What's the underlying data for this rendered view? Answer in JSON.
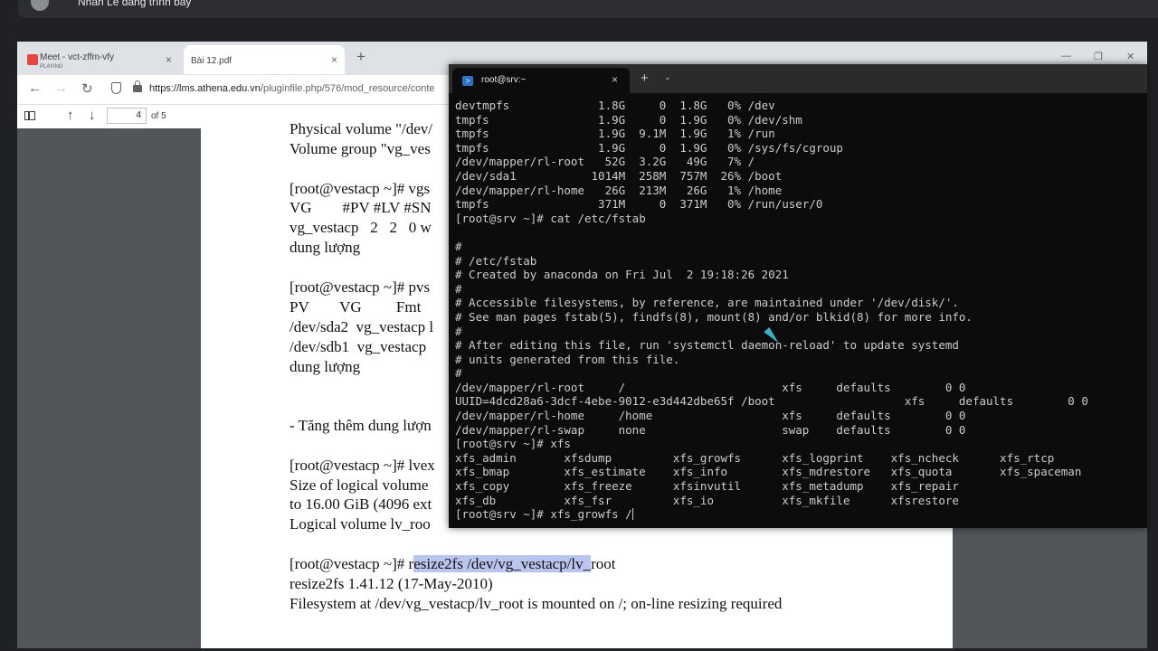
{
  "meet": {
    "presenter": "Nhân Lê đang trình bày"
  },
  "browser": {
    "tabs": [
      {
        "title": "Meet - vct-zffm-vfy",
        "subtitle": "PLAYING",
        "close": "×"
      },
      {
        "title": "Bài 12.pdf",
        "close": "×"
      }
    ],
    "new_tab": "+",
    "nav": {
      "back": "←",
      "forward": "→",
      "reload": "↻"
    },
    "url_domain": "https://lms.athena.edu.vn",
    "url_path": "/pluginfile.php/576/mod_resource/conte",
    "window_controls": {
      "minimize": "—",
      "maximize": "❐",
      "close": "✕"
    }
  },
  "pdf": {
    "toolbar": {
      "up": "↑",
      "down": "↓",
      "page": "4",
      "total": "of 5"
    },
    "lines": [
      {
        "id": "l1",
        "text": "Physical volume \"/dev/"
      },
      {
        "id": "l2",
        "text": "Volume group \"vg_ves"
      },
      {
        "id": "l3",
        "text": "[root@vestacp ~]# vgs"
      },
      {
        "id": "l4",
        "text": "VG        #PV #LV #SN"
      },
      {
        "id": "l5",
        "text": "vg_vestacp   2   2   0 w"
      },
      {
        "id": "l6",
        "text": "dung lượng"
      },
      {
        "id": "l7",
        "text": "[root@vestacp ~]# pvs"
      },
      {
        "id": "l8",
        "text": "PV        VG         Fmt"
      },
      {
        "id": "l9",
        "text": "/dev/sda2  vg_vestacp l"
      },
      {
        "id": "l10",
        "text": "/dev/sdb1  vg_vestacp"
      },
      {
        "id": "l11",
        "text": "dung lượng"
      },
      {
        "id": "l12",
        "text": "- Tăng thêm dung lượn"
      },
      {
        "id": "l13",
        "text": "[root@vestacp ~]# lvex"
      },
      {
        "id": "l14",
        "text": "Size of logical volume"
      },
      {
        "id": "l15",
        "text": "to 16.00 GiB (4096 ext"
      },
      {
        "id": "l16",
        "text": "Logical volume lv_roo"
      }
    ],
    "resize_prompt": "[root@vestacp ~]# r",
    "resize_hl": "esize2fs /dev/vg_vestacp/lv_",
    "resize_tail": "root",
    "line_version": "resize2fs 1.41.12 (17-May-2010)",
    "line_fs": "Filesystem at /dev/vg_vestacp/lv_root is mounted on /; on-line resizing required"
  },
  "terminal": {
    "tab_title": "root@srv:~",
    "tab_close": "×",
    "new_tab": "+",
    "dropdown": "⌄",
    "icon": "powershell-icon",
    "output": "devtmpfs             1.8G     0  1.8G   0% /dev\ntmpfs                1.9G     0  1.9G   0% /dev/shm\ntmpfs                1.9G  9.1M  1.9G   1% /run\ntmpfs                1.9G     0  1.9G   0% /sys/fs/cgroup\n/dev/mapper/rl-root   52G  3.2G   49G   7% /\n/dev/sda1           1014M  258M  757M  26% /boot\n/dev/mapper/rl-home   26G  213M   26G   1% /home\ntmpfs                371M     0  371M   0% /run/user/0\n[root@srv ~]# cat /etc/fstab\n\n#\n# /etc/fstab\n# Created by anaconda on Fri Jul  2 19:18:26 2021\n#\n# Accessible filesystems, by reference, are maintained under '/dev/disk/'.\n# See man pages fstab(5), findfs(8), mount(8) and/or blkid(8) for more info.\n#\n# After editing this file, run 'systemctl daemon-reload' to update systemd\n# units generated from this file.\n#\n/dev/mapper/rl-root     /                       xfs     defaults        0 0\nUUID=4dcd28a6-3dcf-4ebe-9012-e3d442dbe65f /boot                   xfs     defaults        0 0\n/dev/mapper/rl-home     /home                   xfs     defaults        0 0\n/dev/mapper/rl-swap     none                    swap    defaults        0 0\n[root@srv ~]# xfs\nxfs_admin       xfsdump         xfs_growfs      xfs_logprint    xfs_ncheck      xfs_rtcp\nxfs_bmap        xfs_estimate    xfs_info        xfs_mdrestore   xfs_quota       xfs_spaceman\nxfs_copy        xfs_freeze      xfsinvutil      xfs_metadump    xfs_repair\nxfs_db          xfs_fsr         xfs_io          xfs_mkfile      xfsrestore\n[root@srv ~]# xfs_growfs /"
  }
}
